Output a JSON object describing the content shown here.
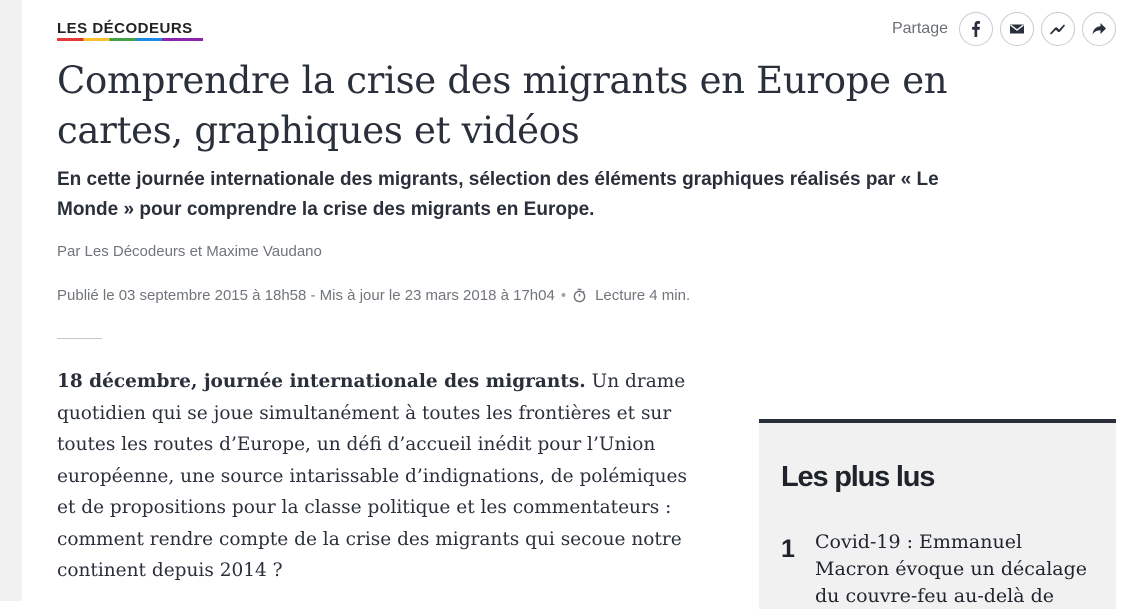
{
  "rubric": {
    "label": "LES DÉCODEURS"
  },
  "share": {
    "label": "Partage",
    "buttons": [
      {
        "name": "facebook-share-button",
        "icon": "facebook-icon"
      },
      {
        "name": "email-share-button",
        "icon": "envelope-icon"
      },
      {
        "name": "messenger-share-button",
        "icon": "messenger-icon"
      },
      {
        "name": "forward-share-button",
        "icon": "share-arrow-icon"
      }
    ]
  },
  "article": {
    "title": "Comprendre la crise des migrants en Europe en cartes, graphiques et vidéos",
    "standfirst": "En cette journée internationale des migrants, sélection des éléments graphiques réalisés par « Le Monde » pour comprendre la crise des migrants en Europe.",
    "byline": "Par Les Décodeurs et Maxime Vaudano",
    "published": "Publié le 03 septembre 2015 à 18h58 - Mis à jour le 23 mars 2018 à 17h04",
    "separator_dot": "•",
    "reading_time": "Lecture 4 min.",
    "body_lead": "18 décembre, journée internationale des migrants.",
    "body_text": " Un drame quotidien qui se joue simultanément à toutes les frontières et sur toutes les routes d’Europe, un défi d’accueil inédit pour l’Union européenne, une source intarissable d’indignations, de polémiques et de propositions pour la classe politique et les commentateurs : comment rendre compte de la crise des migrants qui secoue notre continent depuis 2014 ?"
  },
  "most_read": {
    "heading": "Les plus lus",
    "items": [
      {
        "rank": "1",
        "title": "Covid-19 : Emmanuel Macron évoque un décalage du couvre-feu au-delà de"
      }
    ]
  }
}
